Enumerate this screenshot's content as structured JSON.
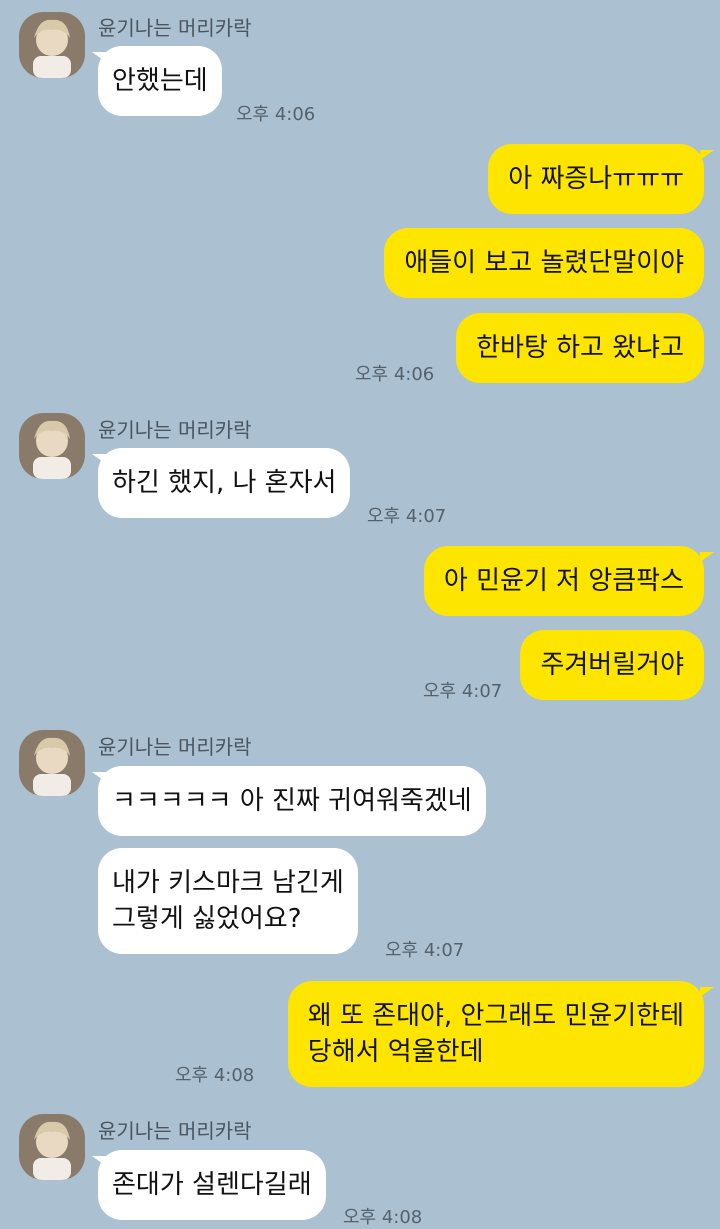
{
  "chat": {
    "sender_name": "윤기나는 머리카락",
    "groups": [
      {
        "sender": "윤기나는 머리카락",
        "messages": [
          "안했는데"
        ],
        "time": "오후 4:06"
      },
      {
        "sender": "me",
        "messages": [
          "아 짜증나ㅠㅠㅠ",
          "애들이 보고 놀렸단말이야",
          "한바탕 하고 왔냐고"
        ],
        "time": "오후 4:06"
      },
      {
        "sender": "윤기나는 머리카락",
        "messages": [
          "하긴 했지, 나 혼자서"
        ],
        "time": "오후 4:07"
      },
      {
        "sender": "me",
        "messages": [
          "아 민윤기 저 앙큼팍스",
          "주겨버릴거야"
        ],
        "time": "오후 4:07"
      },
      {
        "sender": "윤기나는 머리카락",
        "messages": [
          "ㅋㅋㅋㅋㅋ 아 진짜 귀여워죽겠네",
          "내가 키스마크 남긴게\n그렇게 싫었어요?"
        ],
        "time": "오후 4:07"
      },
      {
        "sender": "me",
        "messages": [
          "왜 또 존대야, 안그래도 민윤기한테\n당해서 억울한데"
        ],
        "time": "오후 4:08"
      },
      {
        "sender": "윤기나는 머리카락",
        "messages": [
          "존대가 설렌다길래"
        ],
        "time": "오후 4:08"
      }
    ]
  },
  "colors": {
    "background": "#abc1d1",
    "outgoing_bubble": "#fee500",
    "incoming_bubble": "#ffffff"
  }
}
